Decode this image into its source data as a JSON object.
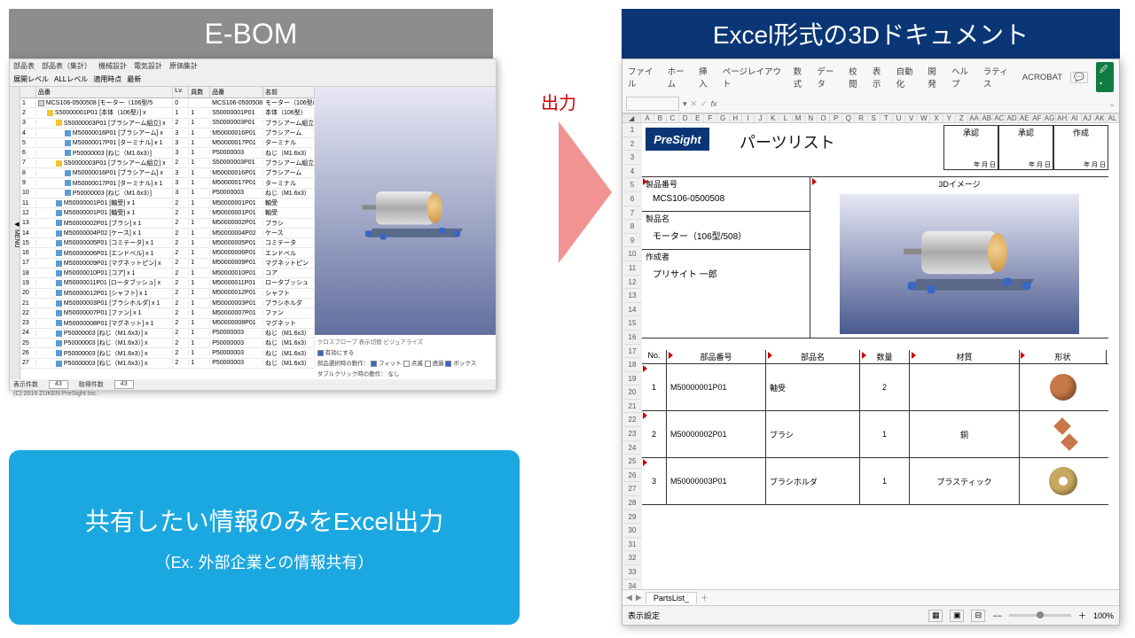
{
  "ebom": {
    "header": "E-BOM",
    "menu": [
      "部品表",
      "部品表（集計）",
      "機械設計",
      "電気設計",
      "原価集計"
    ],
    "toolbar": [
      "展開レベル",
      "ALLレベル",
      "適用時点",
      "最新"
    ],
    "columns": {
      "num": "",
      "name": "品番",
      "lv": "Lv.",
      "qty": "員数",
      "partno": "品番",
      "pname": "名前"
    },
    "rows": [
      {
        "n": 1,
        "indent": 0,
        "icon": "root",
        "name": "MCS106-0500508 [モーター（106型/5",
        "lv": 0,
        "qty": "",
        "pn": "MCS106-0500508",
        "nm": "モーター（106型/508）"
      },
      {
        "n": 2,
        "indent": 1,
        "icon": "folder",
        "name": "S50000001P01 [本体（106型）] x",
        "lv": 1,
        "qty": 1,
        "pn": "S50000001P01",
        "nm": "本体（106型）"
      },
      {
        "n": 3,
        "indent": 2,
        "icon": "folder",
        "name": "S50000003P01 [ブラシアーム組立] x",
        "lv": 2,
        "qty": 1,
        "pn": "S50000003P01",
        "nm": "ブラシアーム組立"
      },
      {
        "n": 4,
        "indent": 3,
        "icon": "part",
        "name": "M50000016P01 [ブラシアーム] x",
        "lv": 3,
        "qty": 1,
        "pn": "M50000016P01",
        "nm": "ブラシアーム"
      },
      {
        "n": 5,
        "indent": 3,
        "icon": "part",
        "name": "M50000017P01 [ターミナル] x 1",
        "lv": 3,
        "qty": 1,
        "pn": "M50000017P01",
        "nm": "ターミナル"
      },
      {
        "n": 6,
        "indent": 3,
        "icon": "part",
        "name": "P50000003 [ねじ（M1.6x3）]",
        "lv": 3,
        "qty": 1,
        "pn": "P50000003",
        "nm": "ねじ（M1.6x3）"
      },
      {
        "n": 7,
        "indent": 2,
        "icon": "folder",
        "name": "S50000003P01 [ブラシアーム組立] x",
        "lv": 2,
        "qty": 1,
        "pn": "S50000003P01",
        "nm": "ブラシアーム組立"
      },
      {
        "n": 8,
        "indent": 3,
        "icon": "part",
        "name": "M50000016P01 [ブラシアーム] x",
        "lv": 3,
        "qty": 1,
        "pn": "M50000016P01",
        "nm": "ブラシアーム"
      },
      {
        "n": 9,
        "indent": 3,
        "icon": "part",
        "name": "M50000017P01 [ターミナル] x 1",
        "lv": 3,
        "qty": 1,
        "pn": "M50000017P01",
        "nm": "ターミナル"
      },
      {
        "n": 10,
        "indent": 3,
        "icon": "part",
        "name": "P50000003 [ねじ（M1.6x3）]",
        "lv": 3,
        "qty": 1,
        "pn": "P50000003",
        "nm": "ねじ（M1.6x3）"
      },
      {
        "n": 11,
        "indent": 2,
        "icon": "part",
        "name": "M50000001P01 [軸受] x 1",
        "lv": 2,
        "qty": 1,
        "pn": "M50000001P01",
        "nm": "軸受"
      },
      {
        "n": 12,
        "indent": 2,
        "icon": "part",
        "name": "M50000001P01 [軸受] x 1",
        "lv": 2,
        "qty": 1,
        "pn": "M50000001P01",
        "nm": "軸受"
      },
      {
        "n": 13,
        "indent": 2,
        "icon": "part",
        "name": "M50000002P01 [ブラシ] x 1",
        "lv": 2,
        "qty": 1,
        "pn": "M50000002P01",
        "nm": "ブラシ"
      },
      {
        "n": 14,
        "indent": 2,
        "icon": "part",
        "name": "M50000004P02 [ケース] x 1",
        "lv": 2,
        "qty": 1,
        "pn": "M50000004P02",
        "nm": "ケース"
      },
      {
        "n": 15,
        "indent": 2,
        "icon": "part",
        "name": "M50000005P01 [コミテータ] x 1",
        "lv": 2,
        "qty": 1,
        "pn": "M50000005P01",
        "nm": "コミテータ"
      },
      {
        "n": 16,
        "indent": 2,
        "icon": "part",
        "name": "M50000006P01 [エンドベル] x 1",
        "lv": 2,
        "qty": 1,
        "pn": "M50000006P01",
        "nm": "エンドベル"
      },
      {
        "n": 17,
        "indent": 2,
        "icon": "part",
        "name": "M50000009P01 [マグネットピン] x",
        "lv": 2,
        "qty": 1,
        "pn": "M50000009P01",
        "nm": "マグネットピン"
      },
      {
        "n": 18,
        "indent": 2,
        "icon": "part",
        "name": "M50000010P01 [コア] x 1",
        "lv": 2,
        "qty": 1,
        "pn": "M50000010P01",
        "nm": "コア"
      },
      {
        "n": 19,
        "indent": 2,
        "icon": "part",
        "name": "M50000011P01 [ロータブッシュ] x",
        "lv": 2,
        "qty": 1,
        "pn": "M50000011P01",
        "nm": "ロータブッシュ"
      },
      {
        "n": 20,
        "indent": 2,
        "icon": "part",
        "name": "M50000012P01 [シャフト] x 1",
        "lv": 2,
        "qty": 1,
        "pn": "M50000012P01",
        "nm": "シャフト"
      },
      {
        "n": 21,
        "indent": 2,
        "icon": "part",
        "name": "M50000003P01 [ブラシホルダ] x 1",
        "lv": 2,
        "qty": 1,
        "pn": "M50000003P01",
        "nm": "ブラシホルダ"
      },
      {
        "n": 22,
        "indent": 2,
        "icon": "part",
        "name": "M50000007P01 [ファン] x 1",
        "lv": 2,
        "qty": 1,
        "pn": "M50000007P01",
        "nm": "ファン"
      },
      {
        "n": 23,
        "indent": 2,
        "icon": "part",
        "name": "M50000008P01 [マグネット] x 1",
        "lv": 2,
        "qty": 1,
        "pn": "M50000008P01",
        "nm": "マグネット"
      },
      {
        "n": 24,
        "indent": 2,
        "icon": "part",
        "name": "P50000003 [ねじ（M1.6x3）] x",
        "lv": 2,
        "qty": 1,
        "pn": "P50000003",
        "nm": "ねじ（M1.6x3）"
      },
      {
        "n": 25,
        "indent": 2,
        "icon": "part",
        "name": "P50000003 [ねじ（M1.6x3）] x",
        "lv": 2,
        "qty": 1,
        "pn": "P50000003",
        "nm": "ねじ（M1.6x3）"
      },
      {
        "n": 26,
        "indent": 2,
        "icon": "part",
        "name": "P50000003 [ねじ（M1.6x3）] x",
        "lv": 2,
        "qty": 1,
        "pn": "P50000003",
        "nm": "ねじ（M1.6x3）"
      },
      {
        "n": 27,
        "indent": 2,
        "icon": "part",
        "name": "P50000003 [ねじ（M1.6x3）] x",
        "lv": 2,
        "qty": 1,
        "pn": "P50000003",
        "nm": "ねじ（M1.6x3）"
      }
    ],
    "viewer": {
      "tabs": "クロスプローブ 表示切替 ビジュアライズ",
      "enable_label": "有効にする",
      "select_label": "部品選択時の動作：",
      "opts": [
        "フィット",
        "点滅",
        "透過",
        "ボックス"
      ],
      "dbl_label": "ダブルクリック時の動作：",
      "dbl_val": "なし"
    },
    "status": {
      "count_label": "表示件数",
      "count": "43",
      "acq_label": "取得件数",
      "acq": "43"
    },
    "footer": "(C) 2016 ZUKEN PreSight Inc."
  },
  "arrow_label": "出力",
  "excel": {
    "header": "Excel形式の3Dドキュメント",
    "tabs": [
      "ファイル",
      "ホーム",
      "挿入",
      "ページレイアウト",
      "数式",
      "データ",
      "校閲",
      "表示",
      "自動化",
      "開発",
      "ヘルプ",
      "ラティス",
      "ACROBAT"
    ],
    "share": "共",
    "fx": "fx",
    "cols": [
      "A",
      "B",
      "C",
      "D",
      "E",
      "F",
      "G",
      "H",
      "I",
      "J",
      "K",
      "L",
      "M",
      "N",
      "O",
      "P",
      "Q",
      "R",
      "S",
      "T",
      "U",
      "V",
      "W",
      "X",
      "Y",
      "Z",
      "AA",
      "AB",
      "AC",
      "AD",
      "AE",
      "AF",
      "AG",
      "AH",
      "AI",
      "AJ",
      "AK",
      "AL"
    ],
    "topright": [
      {
        "hdr": "承認",
        "date": "年 月 日"
      },
      {
        "hdr": "承認",
        "date": "年 月 日"
      },
      {
        "hdr": "作成",
        "date": "年 月 日"
      }
    ],
    "logo": "PreSight",
    "title": "パーツリスト",
    "info": {
      "pn_label": "製品番号",
      "pn": "MCS106-0500508",
      "nm_label": "製品名",
      "nm": "モーター（106型/508）",
      "auth_label": "作成者",
      "auth": "プリサイト 一郎",
      "img_label": "3Dイメージ"
    },
    "table_hdr": {
      "no": "No.",
      "pn": "部品番号",
      "nm": "部品名",
      "qt": "数量",
      "mt": "材質",
      "sh": "形状"
    },
    "table_rows": [
      {
        "no": "1",
        "pn": "M50000001P01",
        "nm": "軸受",
        "qt": "2",
        "mt": "",
        "shape": 1
      },
      {
        "no": "2",
        "pn": "M50000002P01",
        "nm": "ブラシ",
        "qt": "1",
        "mt": "銅",
        "shape": 2
      },
      {
        "no": "3",
        "pn": "M50000003P01",
        "nm": "ブラシホルダ",
        "qt": "1",
        "mt": "プラスティック",
        "shape": 3
      }
    ],
    "sheet_tab": "PartsList_",
    "status_text": "表示設定",
    "zoom": "100%"
  },
  "bottom": {
    "line1": "共有したい情報のみをExcel出力",
    "line2": "（Ex. 外部企業との情報共有）"
  }
}
